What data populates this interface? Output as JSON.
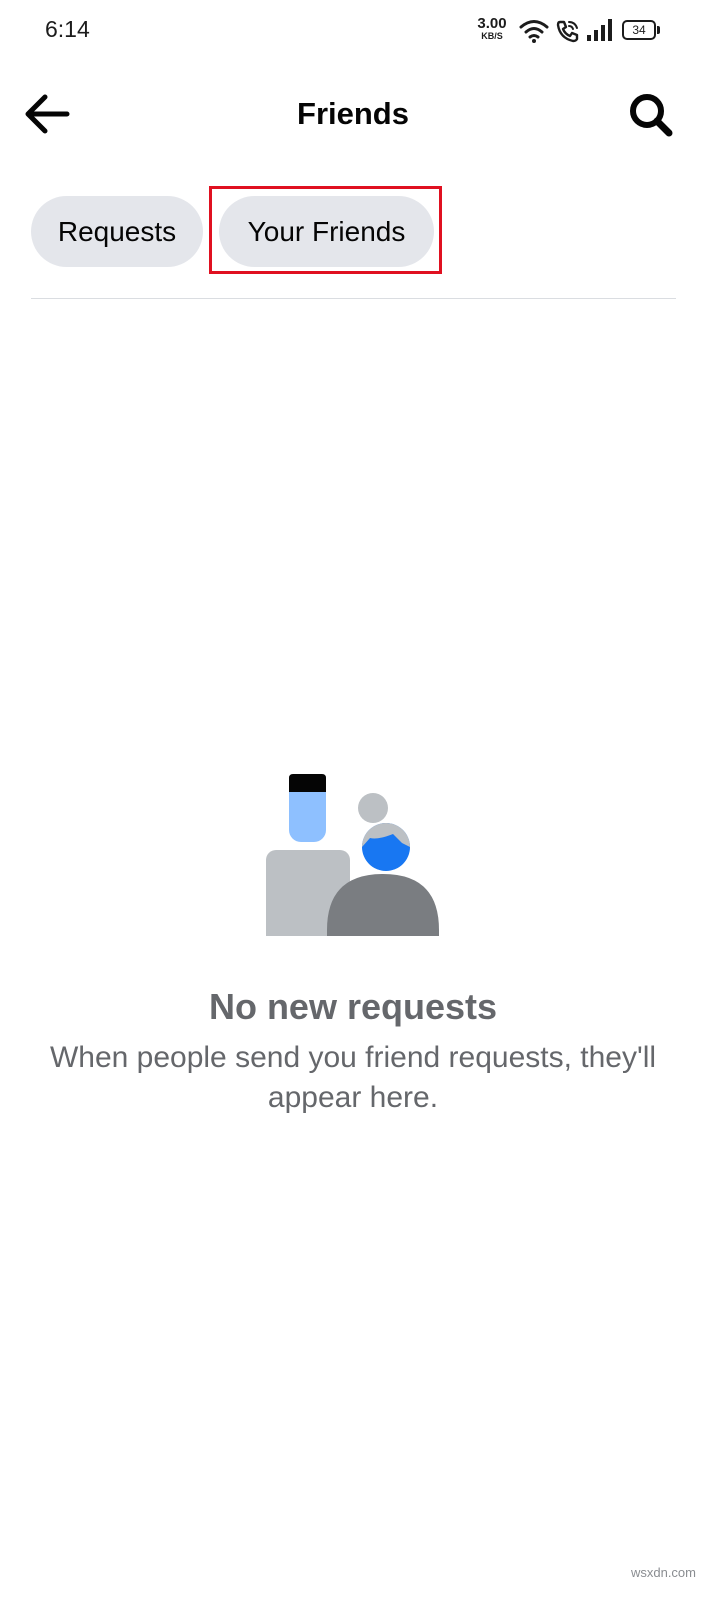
{
  "status_bar": {
    "time": "6:14",
    "net_speed_value": "3.00",
    "net_speed_unit": "KB/S",
    "battery_level": "34"
  },
  "header": {
    "title": "Friends",
    "back_icon": "arrow-left-icon",
    "search_icon": "search-icon"
  },
  "tabs": [
    {
      "label": "Requests"
    },
    {
      "label": "Your Friends"
    }
  ],
  "empty_state": {
    "title": "No new requests",
    "description": "When people send you friend requests, they'll appear here."
  },
  "watermark": "wsxdn.com",
  "colors": {
    "chip_bg": "#e4e6eb",
    "highlight": "#e01020",
    "secondary_text": "#65676b",
    "accent_blue": "#1877f2",
    "light_blue": "#8ec0ff"
  }
}
